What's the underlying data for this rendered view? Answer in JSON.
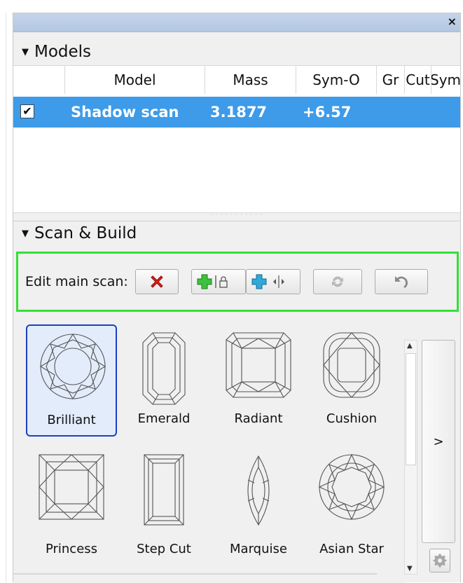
{
  "window": {
    "close_glyph": "×"
  },
  "models": {
    "title": "Models",
    "columns": [
      "Model",
      "Mass",
      "Sym-O",
      "Gr",
      "Cut",
      "Sym"
    ],
    "rows": [
      {
        "checked": true,
        "check_glyph": "✔",
        "model": "Shadow scan",
        "mass": "3.1877",
        "sym_o": "+6.57"
      }
    ]
  },
  "scan_build": {
    "title": "Scan & Build",
    "edit_label": "Edit main scan:",
    "buttons": [
      {
        "name": "delete-scan",
        "icon": "red-x-icon"
      },
      {
        "name": "add-locked",
        "icon": "green-plus-lock-icon"
      },
      {
        "name": "add-resize",
        "icon": "blue-plus-resize-icon"
      },
      {
        "name": "refresh",
        "icon": "refresh-icon"
      },
      {
        "name": "undo",
        "icon": "undo-icon"
      }
    ],
    "shapes": [
      "Brilliant",
      "Emerald",
      "Radiant",
      "Cushion",
      "Princess",
      "Step Cut",
      "Marquise",
      "Asian Star"
    ],
    "selected_shape": "Brilliant",
    "more_label": ">"
  },
  "colors": {
    "selection": "#3d9be9",
    "highlight_border": "#35e035",
    "selected_shape_border": "#2040c0"
  }
}
